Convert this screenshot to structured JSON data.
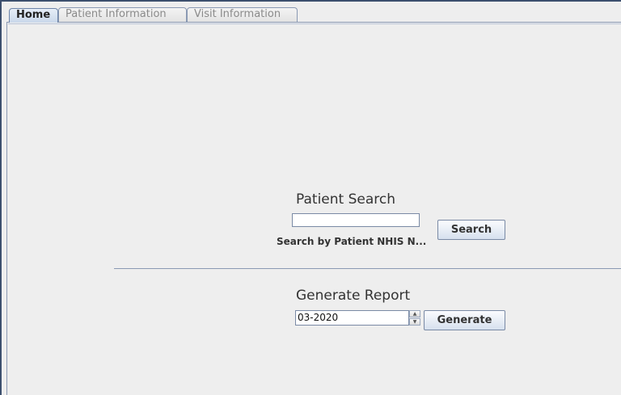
{
  "tabs": [
    {
      "label": "Home",
      "active": true
    },
    {
      "label": "Patient Information",
      "active": false
    },
    {
      "label": "Visit Information",
      "active": false
    }
  ],
  "patient_search": {
    "heading": "Patient Search",
    "input_value": "",
    "hint": "Search by Patient NHIS N...",
    "button_label": "Search"
  },
  "generate_report": {
    "heading": "Generate Report",
    "date_value": "03-2020",
    "spin_up_glyph": "▲",
    "spin_down_glyph": "▼",
    "button_label": "Generate"
  }
}
